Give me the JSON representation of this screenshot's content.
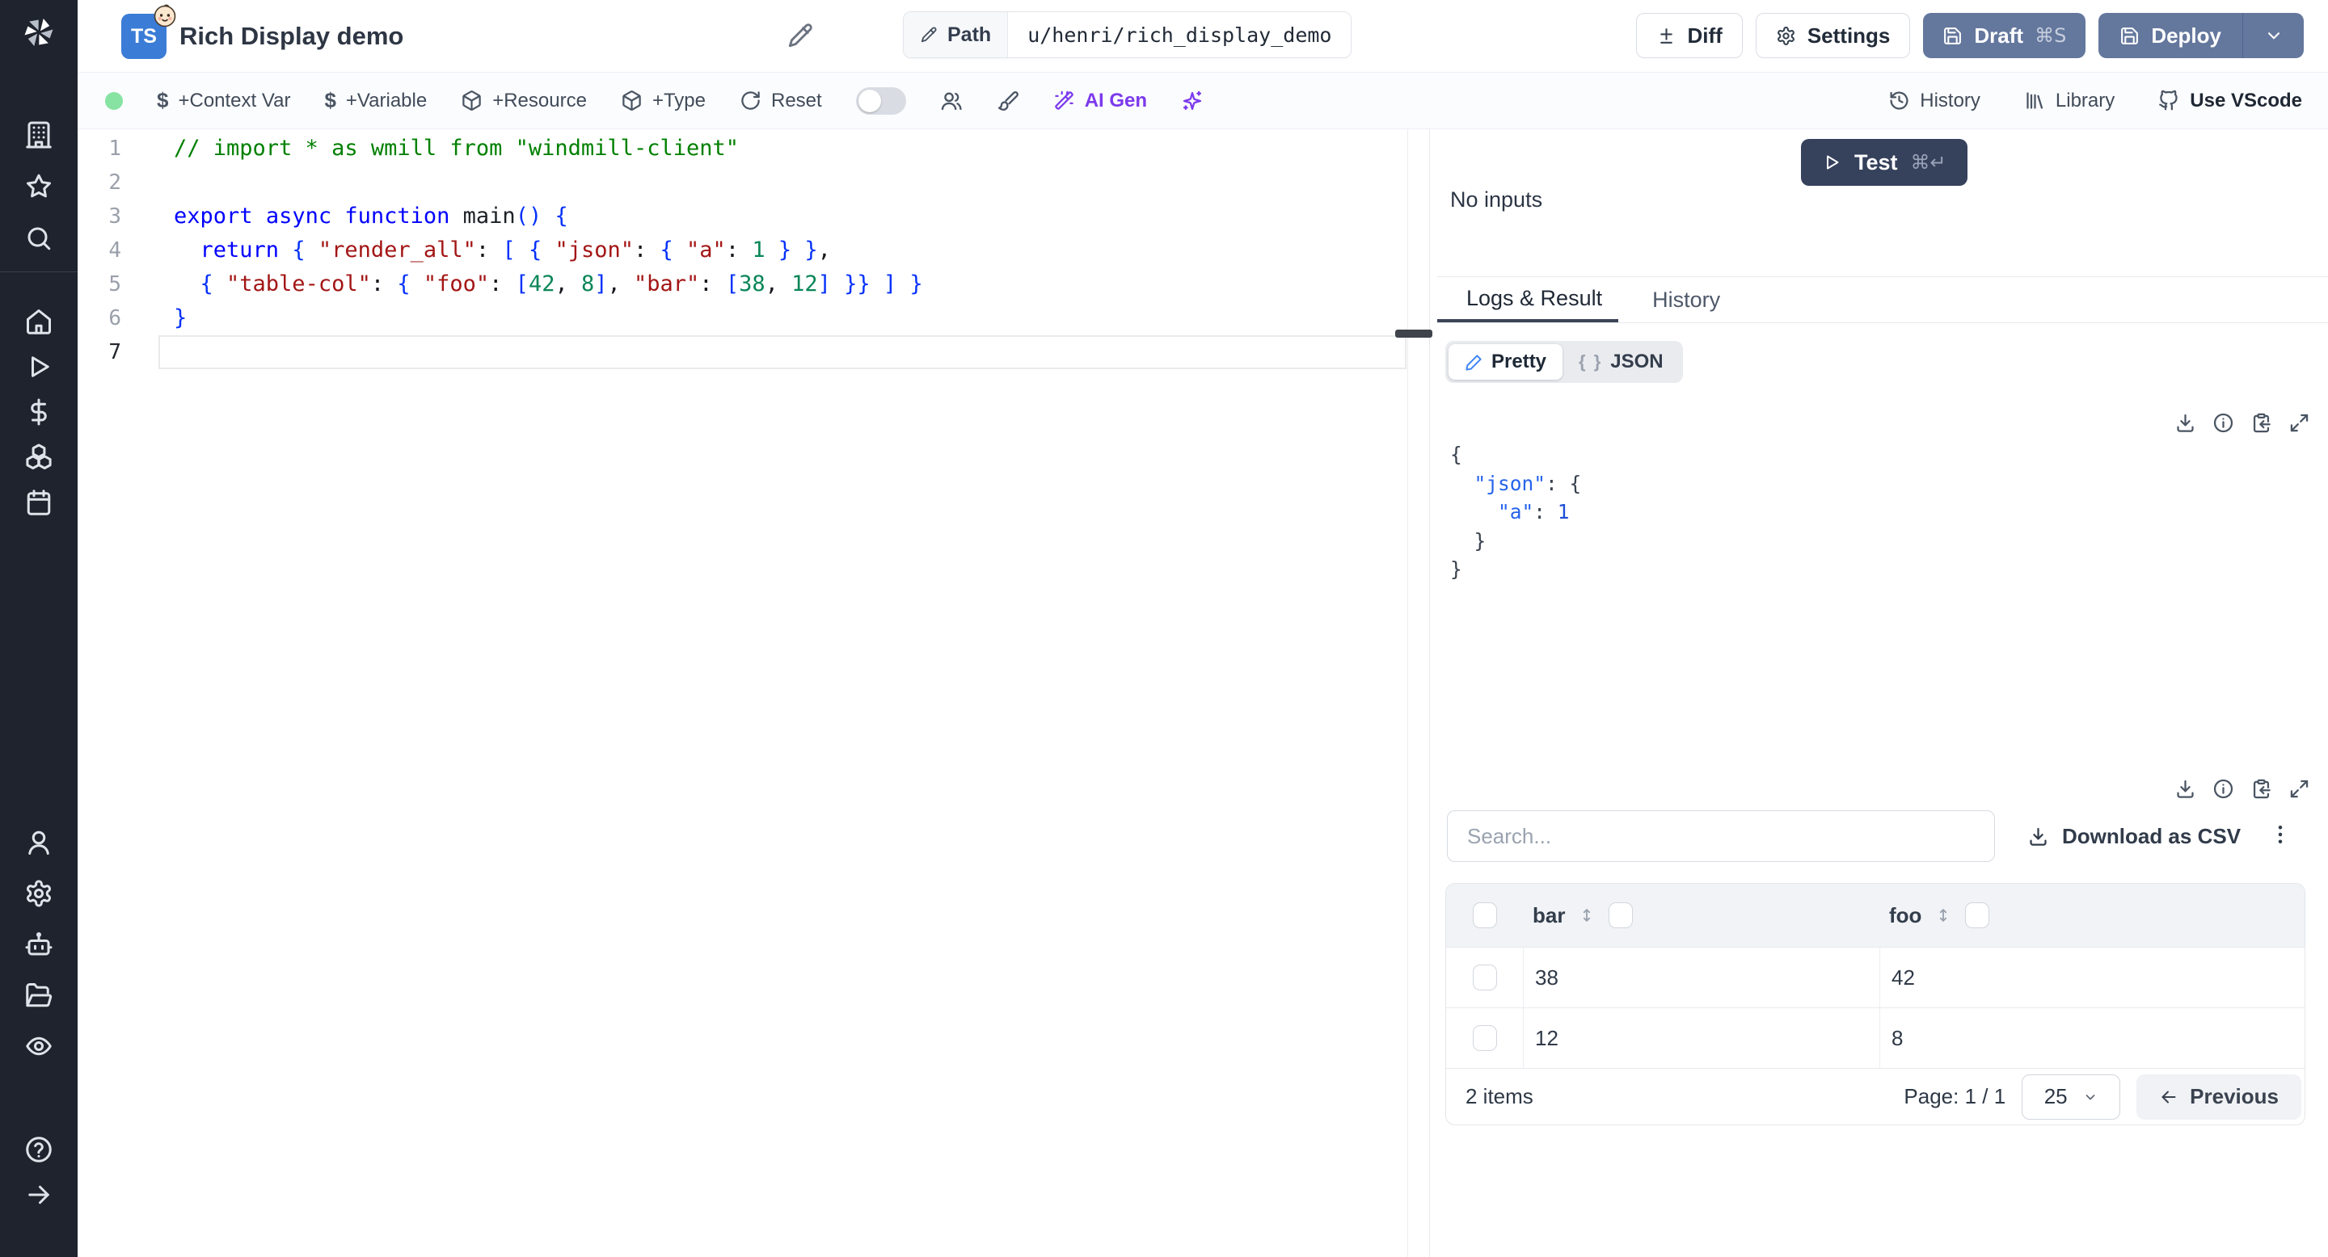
{
  "colors": {
    "sidebar-bg": "#1e232e",
    "primary-btn": "#64779d",
    "primary-divider": "#51648c",
    "test-btn": "#36415c",
    "ai-accent": "#7c3aed",
    "status-dot": "#86e3a1",
    "tab-underline": "#3b4556",
    "pen-blue": "#3b82f6",
    "json-key": "#2563eb",
    "json-val": "#1d4ed8",
    "ts-badge": "#3b7cd6",
    "code-cm": "#008000",
    "code-kw": "#0000ff",
    "code-str": "#a31515",
    "code-num": "#098658",
    "code-br": "#0431fa"
  },
  "header": {
    "badge": "TS",
    "title": "Rich Display demo",
    "path_label": "Path",
    "path_value": "u/henri/rich_display_demo",
    "diff": "Diff",
    "settings": "Settings",
    "draft": "Draft",
    "draft_shortcut": "⌘S",
    "deploy": "Deploy"
  },
  "toolbar": {
    "dollar": "$",
    "context_var": "+Context Var",
    "variable": "+Variable",
    "resource": "+Resource",
    "type": "+Type",
    "reset": "Reset",
    "ai_gen": "AI Gen",
    "history": "History",
    "library": "Library",
    "vscode": "Use VScode"
  },
  "sidebar": {
    "top_icons": [
      "building",
      "star",
      "search"
    ],
    "mid_icons": [
      "home",
      "play",
      "dollar",
      "boxes",
      "calendar"
    ],
    "low_icons": [
      "user",
      "settings",
      "bot",
      "folder-open",
      "eye"
    ],
    "footer_icons": [
      "help",
      "arrow-right"
    ]
  },
  "editor": {
    "lines": [
      {
        "tokens": [
          {
            "t": "// import * as wmill from \"windmill-client\"",
            "c": "cm"
          }
        ]
      },
      {
        "tokens": []
      },
      {
        "tokens": [
          {
            "t": "export",
            "c": "kw"
          },
          {
            "t": " ",
            "c": "pl"
          },
          {
            "t": "async",
            "c": "kw"
          },
          {
            "t": " ",
            "c": "pl"
          },
          {
            "t": "function",
            "c": "kw"
          },
          {
            "t": " main",
            "c": "fn"
          },
          {
            "t": "() {",
            "c": "br"
          }
        ]
      },
      {
        "tokens": [
          {
            "t": "  ",
            "c": "pl"
          },
          {
            "t": "return",
            "c": "kw"
          },
          {
            "t": " ",
            "c": "pl"
          },
          {
            "t": "{ ",
            "c": "br"
          },
          {
            "t": "\"render_all\"",
            "c": "str"
          },
          {
            "t": ": ",
            "c": "pl"
          },
          {
            "t": "[ { ",
            "c": "br"
          },
          {
            "t": "\"json\"",
            "c": "str"
          },
          {
            "t": ": ",
            "c": "pl"
          },
          {
            "t": "{ ",
            "c": "br"
          },
          {
            "t": "\"a\"",
            "c": "str"
          },
          {
            "t": ": ",
            "c": "pl"
          },
          {
            "t": "1",
            "c": "num"
          },
          {
            "t": " } }",
            "c": "br"
          },
          {
            "t": ",",
            "c": "pl"
          }
        ]
      },
      {
        "tokens": [
          {
            "t": "  ",
            "c": "pl"
          },
          {
            "t": "{ ",
            "c": "br"
          },
          {
            "t": "\"table-col\"",
            "c": "str"
          },
          {
            "t": ": ",
            "c": "pl"
          },
          {
            "t": "{ ",
            "c": "br"
          },
          {
            "t": "\"foo\"",
            "c": "str"
          },
          {
            "t": ": ",
            "c": "pl"
          },
          {
            "t": "[",
            "c": "br"
          },
          {
            "t": "42",
            "c": "num"
          },
          {
            "t": ", ",
            "c": "pl"
          },
          {
            "t": "8",
            "c": "num"
          },
          {
            "t": "]",
            "c": "br"
          },
          {
            "t": ", ",
            "c": "pl"
          },
          {
            "t": "\"bar\"",
            "c": "str"
          },
          {
            "t": ": ",
            "c": "pl"
          },
          {
            "t": "[",
            "c": "br"
          },
          {
            "t": "38",
            "c": "num"
          },
          {
            "t": ", ",
            "c": "pl"
          },
          {
            "t": "12",
            "c": "num"
          },
          {
            "t": "] }} ] }",
            "c": "br"
          }
        ]
      },
      {
        "tokens": [
          {
            "t": "}",
            "c": "br"
          }
        ]
      },
      {
        "tokens": [],
        "active": true
      }
    ]
  },
  "run_panel": {
    "test": "Test",
    "test_shortcut": "⌘↵",
    "no_inputs": "No inputs",
    "tabs": {
      "active": "Logs & Result",
      "inactive": "History"
    },
    "view": {
      "pretty": "Pretty",
      "braces": "{ }",
      "json": "JSON"
    },
    "result_json": {
      "lines": [
        [
          {
            "t": "{",
            "c": "p"
          }
        ],
        [
          {
            "t": "  ",
            "c": "p"
          },
          {
            "t": "\"json\"",
            "c": "k"
          },
          {
            "t": ": {",
            "c": "p"
          }
        ],
        [
          {
            "t": "    ",
            "c": "p"
          },
          {
            "t": "\"a\"",
            "c": "k"
          },
          {
            "t": ": ",
            "c": "p"
          },
          {
            "t": "1",
            "c": "v"
          }
        ],
        [
          {
            "t": "  }",
            "c": "p"
          }
        ],
        [
          {
            "t": "}",
            "c": "p"
          }
        ]
      ]
    },
    "table": {
      "search_placeholder": "Search...",
      "download_csv": "Download as CSV",
      "columns": [
        "bar",
        "foo"
      ],
      "rows": [
        [
          "38",
          "42"
        ],
        [
          "12",
          "8"
        ]
      ],
      "items_label": "2 items",
      "page_label": "Page: 1 / 1",
      "page_size": "25",
      "previous": "Previous"
    }
  }
}
